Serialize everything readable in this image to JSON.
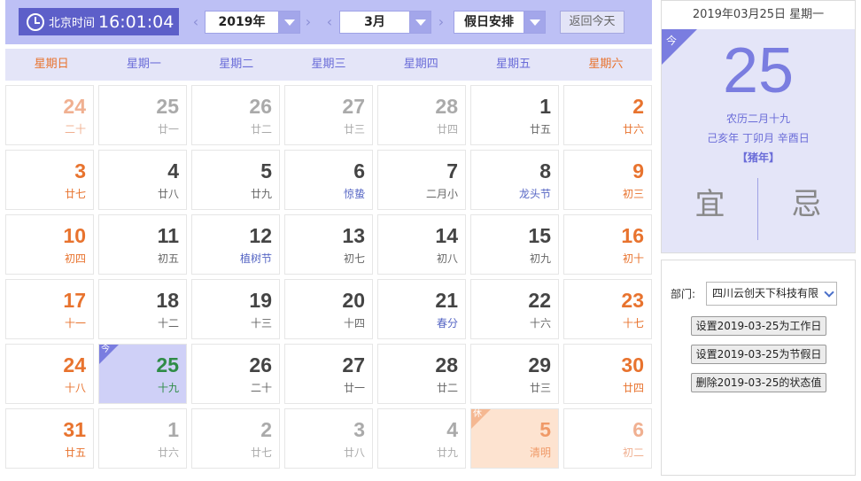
{
  "header": {
    "clock_label": "北京时间",
    "clock_time": "16:01:04",
    "prev_year_icon": "chevron-left-icon",
    "year": "2019年",
    "next_year_icon": "chevron-right-icon",
    "prev_month_icon": "chevron-left-icon",
    "month": "3月",
    "next_month_icon": "chevron-right-icon",
    "holiday_select": "假日安排",
    "today_button": "返回今天"
  },
  "weekdays": [
    "星期日",
    "星期一",
    "星期二",
    "星期三",
    "星期四",
    "星期五",
    "星期六"
  ],
  "calendar": {
    "today_tag": "今",
    "rest_tag": "休",
    "days": [
      {
        "num": "24",
        "lunar": "二十",
        "other": true,
        "weekend": true
      },
      {
        "num": "25",
        "lunar": "廿一",
        "other": true
      },
      {
        "num": "26",
        "lunar": "廿二",
        "other": true
      },
      {
        "num": "27",
        "lunar": "廿三",
        "other": true
      },
      {
        "num": "28",
        "lunar": "廿四",
        "other": true
      },
      {
        "num": "1",
        "lunar": "廿五"
      },
      {
        "num": "2",
        "lunar": "廿六",
        "weekend": true
      },
      {
        "num": "3",
        "lunar": "廿七",
        "weekend": true
      },
      {
        "num": "4",
        "lunar": "廿八"
      },
      {
        "num": "5",
        "lunar": "廿九"
      },
      {
        "num": "6",
        "lunar": "惊蛰",
        "festival": true
      },
      {
        "num": "7",
        "lunar": "二月小"
      },
      {
        "num": "8",
        "lunar": "龙头节",
        "festival": true
      },
      {
        "num": "9",
        "lunar": "初三",
        "weekend": true
      },
      {
        "num": "10",
        "lunar": "初四",
        "weekend": true
      },
      {
        "num": "11",
        "lunar": "初五"
      },
      {
        "num": "12",
        "lunar": "植树节",
        "festival": true
      },
      {
        "num": "13",
        "lunar": "初七"
      },
      {
        "num": "14",
        "lunar": "初八"
      },
      {
        "num": "15",
        "lunar": "初九"
      },
      {
        "num": "16",
        "lunar": "初十",
        "weekend": true
      },
      {
        "num": "17",
        "lunar": "十一",
        "weekend": true
      },
      {
        "num": "18",
        "lunar": "十二"
      },
      {
        "num": "19",
        "lunar": "十三"
      },
      {
        "num": "20",
        "lunar": "十四"
      },
      {
        "num": "21",
        "lunar": "春分",
        "festival": true
      },
      {
        "num": "22",
        "lunar": "十六"
      },
      {
        "num": "23",
        "lunar": "十七",
        "weekend": true
      },
      {
        "num": "24",
        "lunar": "十八",
        "weekend": true
      },
      {
        "num": "25",
        "lunar": "十九",
        "today": true
      },
      {
        "num": "26",
        "lunar": "二十"
      },
      {
        "num": "27",
        "lunar": "廿一"
      },
      {
        "num": "28",
        "lunar": "廿二"
      },
      {
        "num": "29",
        "lunar": "廿三"
      },
      {
        "num": "30",
        "lunar": "廿四",
        "weekend": true
      },
      {
        "num": "31",
        "lunar": "廿五",
        "weekend": true
      },
      {
        "num": "1",
        "lunar": "廿六",
        "other": true
      },
      {
        "num": "2",
        "lunar": "廿七",
        "other": true
      },
      {
        "num": "3",
        "lunar": "廿八",
        "other": true
      },
      {
        "num": "4",
        "lunar": "廿九",
        "other": true
      },
      {
        "num": "5",
        "lunar": "清明",
        "other": true,
        "holiday": true
      },
      {
        "num": "6",
        "lunar": "初二",
        "other": true,
        "weekend": true
      }
    ]
  },
  "info": {
    "date_line": "2019年03月25日 星期一",
    "today_tag": "今",
    "big_day": "25",
    "lunar_date": "农历二月十九",
    "ganzhi": "己亥年 丁卯月 辛酉日",
    "zodiac": "【猪年】",
    "yi": "宜",
    "ji": "忌"
  },
  "actions": {
    "dept_label": "部门:",
    "dept_value": "四川云创天下科技有限",
    "set_workday": "设置2019-03-25为工作日",
    "set_holiday": "设置2019-03-25为节假日",
    "delete_status": "删除2019-03-25的状态值"
  },
  "colors": {
    "accent": "#7a7de0",
    "toolbar_bg": "#bdc0f5",
    "weekend": "#e8732e",
    "today_bg": "#cfd0f7",
    "holiday_bg": "#fde3d0"
  }
}
